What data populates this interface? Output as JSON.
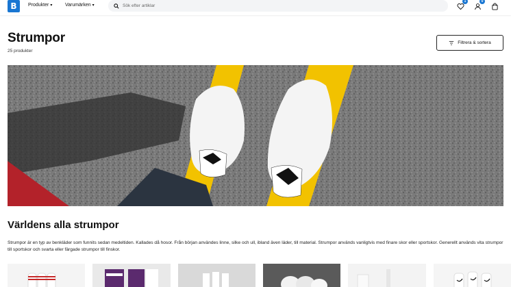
{
  "header": {
    "logo_letter": "B",
    "nav": [
      {
        "label": "Produkter"
      },
      {
        "label": "Varumärken"
      }
    ],
    "search": {
      "placeholder": "Sök efter artiklar"
    },
    "wishlist_count": "1",
    "account_count": "0",
    "colors": {
      "brand": "#1976d2"
    }
  },
  "page": {
    "title": "Strumpor",
    "product_count": "25 produkter",
    "filter_button": "Filtrera & sortera"
  },
  "section": {
    "title": "Världens alla strumpor",
    "text": "Strumpor är en typ av benkläder som funnits sedan medeltiden. Kallades då hosor. Från början användes linne, silke och ull, ibland även läder,  till material. Strumpor används vanligtvis med finare skor eller sportskor. Generellt används vita strumpor till sportskor och svarta eller färgade strumpor till finskor."
  },
  "thumbnails": [
    {
      "alt": "white-socks-red-stripes"
    },
    {
      "alt": "purple-white-socks"
    },
    {
      "alt": "white-sports-socks"
    },
    {
      "alt": "white-socks-dark-background"
    },
    {
      "alt": "white-socks-pack"
    },
    {
      "alt": "white-nike-socks"
    }
  ]
}
